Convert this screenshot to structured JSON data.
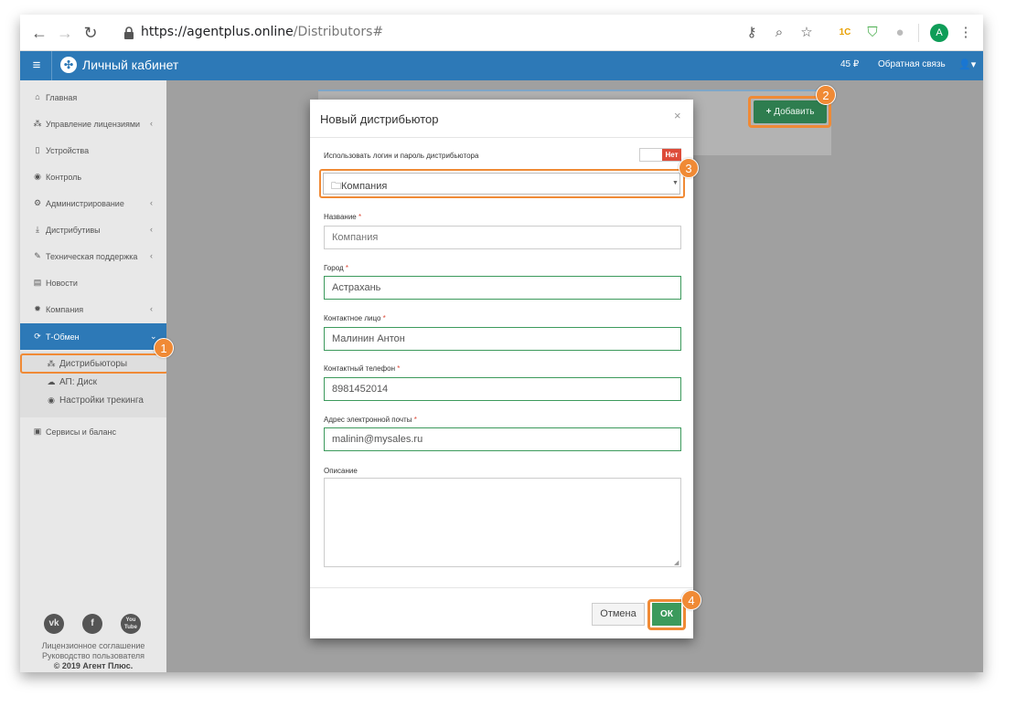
{
  "browser": {
    "url_host": "https://agentplus.online",
    "url_path": "/Distributors#",
    "ext_1c": "1C",
    "avatar_letter": "A"
  },
  "topbar": {
    "brand_title": "Личный кабинет",
    "balance": "45 ₽",
    "feedback": "Обратная связь"
  },
  "sidebar": {
    "items": [
      {
        "label": "Главная",
        "icon": "home-icon"
      },
      {
        "label": "Управление лицензиями",
        "icon": "sitemap-icon"
      },
      {
        "label": "Устройства",
        "icon": "mobile-icon"
      },
      {
        "label": "Контроль",
        "icon": "eye-icon"
      },
      {
        "label": "Администрирование",
        "icon": "cogs-icon"
      },
      {
        "label": "Дистрибутивы",
        "icon": "download-icon"
      },
      {
        "label": "Техническая поддержка",
        "icon": "wrench-icon"
      },
      {
        "label": "Новости",
        "icon": "newspaper-icon"
      },
      {
        "label": "Компания",
        "icon": "gear-icon"
      },
      {
        "label": "Т-Обмен",
        "icon": "refresh-icon"
      }
    ],
    "sub_items": [
      {
        "label": "Дистрибьюторы",
        "icon": "sitemap-icon"
      },
      {
        "label": "АП: Диск",
        "icon": "cloud-icon"
      },
      {
        "label": "Настройки трекинга",
        "icon": "eye-icon"
      }
    ],
    "services": "Сервисы и баланс",
    "social": [
      "vk",
      "f",
      "You Tube"
    ],
    "footer": {
      "license": "Лицензионное соглашение",
      "guide": "Руководство пользователя",
      "copyright": "© 2019 Агент Плюс."
    }
  },
  "main": {
    "add_button": "Добавить"
  },
  "callouts": [
    "1",
    "2",
    "3",
    "4"
  ],
  "modal": {
    "title": "Новый дистрибьютор",
    "close": "×",
    "use_login_label": "Использовать логин и пароль дистрибьютора",
    "toggle_value": "Нет",
    "company_select": "Компания",
    "fields": {
      "name_label": "Название",
      "name_placeholder": "Компания",
      "city_label": "Город",
      "city_value": "Астрахань",
      "contact_label": "Контактное лицо",
      "contact_value": "Малинин Антон",
      "phone_label": "Контактный телефон",
      "phone_value": "8981452014",
      "email_label": "Адрес электронной почты",
      "email_value": "malinin@mysales.ru",
      "desc_label": "Описание"
    },
    "required_mark": "*",
    "cancel": "Отмена",
    "ok": "ОК"
  },
  "colors": {
    "primary": "#2d79b7",
    "success": "#3c9a5c",
    "danger": "#dd4b39",
    "highlight": "#f08a35"
  }
}
